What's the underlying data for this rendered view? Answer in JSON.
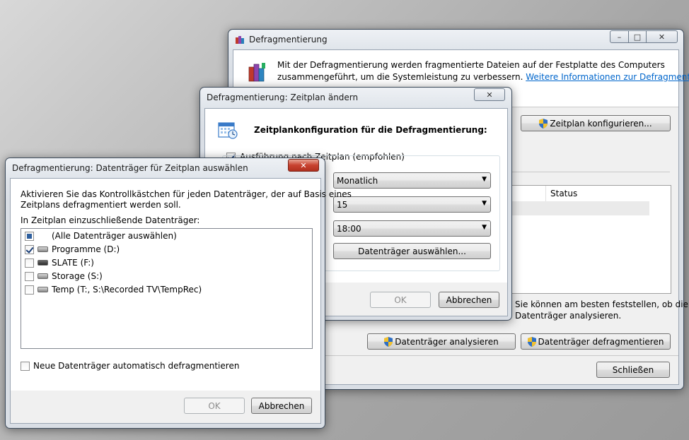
{
  "main": {
    "title": "Defragmentierung",
    "description_line1": "Mit der Defragmentierung werden fragmentierte Dateien auf der Festplatte des Computers",
    "description_line2": "zusammengeführt, um die Systemleistung zu verbessern.",
    "more_info_link": "Weitere Informationen zur Defragmentierung",
    "configure_schedule_button": "Zeitplan konfigurieren...",
    "status_header": "Status",
    "info_line1": "Sie können am besten feststellen, ob die",
    "info_line2": "Datenträger analysieren.",
    "analyze_button": "Datenträger analysieren",
    "defrag_button": "Datenträger defragmentieren",
    "close_button": "Schließen"
  },
  "schedule": {
    "title": "Defragmentierung: Zeitplan ändern",
    "heading": "Zeitplankonfiguration für die Defragmentierung:",
    "run_on_schedule_label": "Ausführung nach Zeitplan (empfohlen)",
    "frequency_value": "Monatlich",
    "day_value": "15",
    "time_value": "18:00",
    "select_disks_button": "Datenträger auswählen...",
    "ok_button": "OK",
    "cancel_button": "Abbrechen"
  },
  "disks": {
    "title": "Defragmentierung: Datenträger für Zeitplan auswählen",
    "instruction_line1": "Aktivieren Sie das Kontrollkästchen für jeden Datenträger, der auf Basis eines",
    "instruction_line2": "Zeitplans defragmentiert werden soll.",
    "list_label": "In Zeitplan einzuschließende Datenträger:",
    "items": [
      {
        "label": "(Alle Datenträger auswählen)",
        "state": "partial"
      },
      {
        "label": "Programme (D:)",
        "state": "checked"
      },
      {
        "label": "SLATE (F:)",
        "state": "unchecked"
      },
      {
        "label": "Storage (S:)",
        "state": "unchecked"
      },
      {
        "label": "Temp (T:, S:\\Recorded TV\\TempRec)",
        "state": "unchecked"
      }
    ],
    "auto_defrag_label": "Neue Datenträger automatisch defragmentieren",
    "ok_button": "OK",
    "cancel_button": "Abbrechen"
  },
  "colors": {
    "link": "#0066cc",
    "close_red": "#c8412f"
  }
}
